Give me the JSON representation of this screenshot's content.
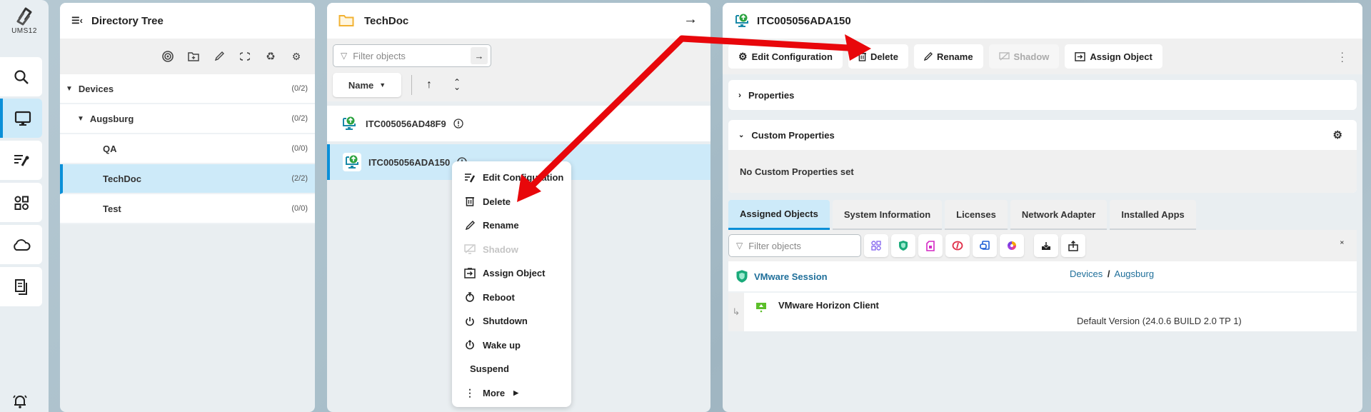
{
  "app": {
    "logo_text": "UMS12"
  },
  "rail": {
    "items": [
      {
        "name": "search",
        "icon": "search-icon"
      },
      {
        "name": "devices",
        "icon": "monitor-icon",
        "active": true
      },
      {
        "name": "configuration",
        "icon": "config-wrench-icon"
      },
      {
        "name": "apps",
        "icon": "apps-grid-icon"
      },
      {
        "name": "cloud",
        "icon": "cloud-icon"
      },
      {
        "name": "documents",
        "icon": "documents-icon"
      }
    ],
    "bottom_icon": "bell-icon"
  },
  "directory_tree": {
    "title": "Directory Tree",
    "tools": [
      "target-icon",
      "new-folder-icon",
      "edit-icon",
      "refresh-icon",
      "recycle-icon",
      "settings-export-icon"
    ],
    "nodes": [
      {
        "label": "Devices",
        "count": "(0/2)",
        "level": 0,
        "expanded": true
      },
      {
        "label": "Augsburg",
        "count": "(0/2)",
        "level": 1,
        "expanded": true
      },
      {
        "label": "QA",
        "count": "(0/0)",
        "level": 2
      },
      {
        "label": "TechDoc",
        "count": "(2/2)",
        "level": 2,
        "selected": true
      },
      {
        "label": "Test",
        "count": "(0/0)",
        "level": 2
      }
    ]
  },
  "device_list": {
    "title": "TechDoc",
    "filter_placeholder": "Filter objects",
    "sort_label": "Name",
    "devices": [
      {
        "name": "ITC005056AD48F9"
      },
      {
        "name": "ITC005056ADA150",
        "selected": true
      }
    ]
  },
  "context_menu": {
    "items": [
      {
        "label": "Edit Configuration",
        "icon": "config-wrench-icon"
      },
      {
        "label": "Delete",
        "icon": "trash-icon"
      },
      {
        "label": "Rename",
        "icon": "pencil-icon"
      },
      {
        "label": "Shadow",
        "icon": "shadow-icon",
        "disabled": true
      },
      {
        "label": "Assign Object",
        "icon": "assign-icon"
      },
      {
        "label": "Reboot",
        "icon": "reboot-icon"
      },
      {
        "label": "Shutdown",
        "icon": "power-icon"
      },
      {
        "label": "Wake up",
        "icon": "wakeup-icon"
      },
      {
        "label": "Suspend",
        "icon": ""
      },
      {
        "label": "More",
        "icon": "kebab-icon",
        "submenu": true
      }
    ]
  },
  "details": {
    "title": "ITC005056ADA150",
    "actions": [
      {
        "label": "Edit Configuration",
        "icon": "gear-icon"
      },
      {
        "label": "Delete",
        "icon": "trash-icon"
      },
      {
        "label": "Rename",
        "icon": "pencil-icon"
      },
      {
        "label": "Shadow",
        "icon": "shadow-icon",
        "disabled": true
      },
      {
        "label": "Assign Object",
        "icon": "assign-icon"
      }
    ],
    "properties_label": "Properties",
    "custom_properties_label": "Custom Properties",
    "custom_properties_empty": "No Custom Properties set",
    "tabs": [
      {
        "label": "Assigned Objects",
        "active": true
      },
      {
        "label": "System Information"
      },
      {
        "label": "Licenses"
      },
      {
        "label": "Network Adapter"
      },
      {
        "label": "Installed Apps"
      }
    ],
    "filter_placeholder": "Filter objects",
    "filter_types": [
      "all-types-icon",
      "profile-shield-icon",
      "sim-card-icon",
      "firmware-icon",
      "app-icon",
      "universal-icon"
    ],
    "filter_actions": [
      "import-icon",
      "export-icon"
    ],
    "assigned": {
      "name": "VMware Session",
      "path": [
        "Devices",
        "Augsburg"
      ],
      "child": {
        "name": "VMware Horizon Client",
        "version": "Default Version (24.0.6 BUILD 2.0 TP 1)"
      }
    }
  },
  "annotation": {
    "color": "#e8070b"
  }
}
